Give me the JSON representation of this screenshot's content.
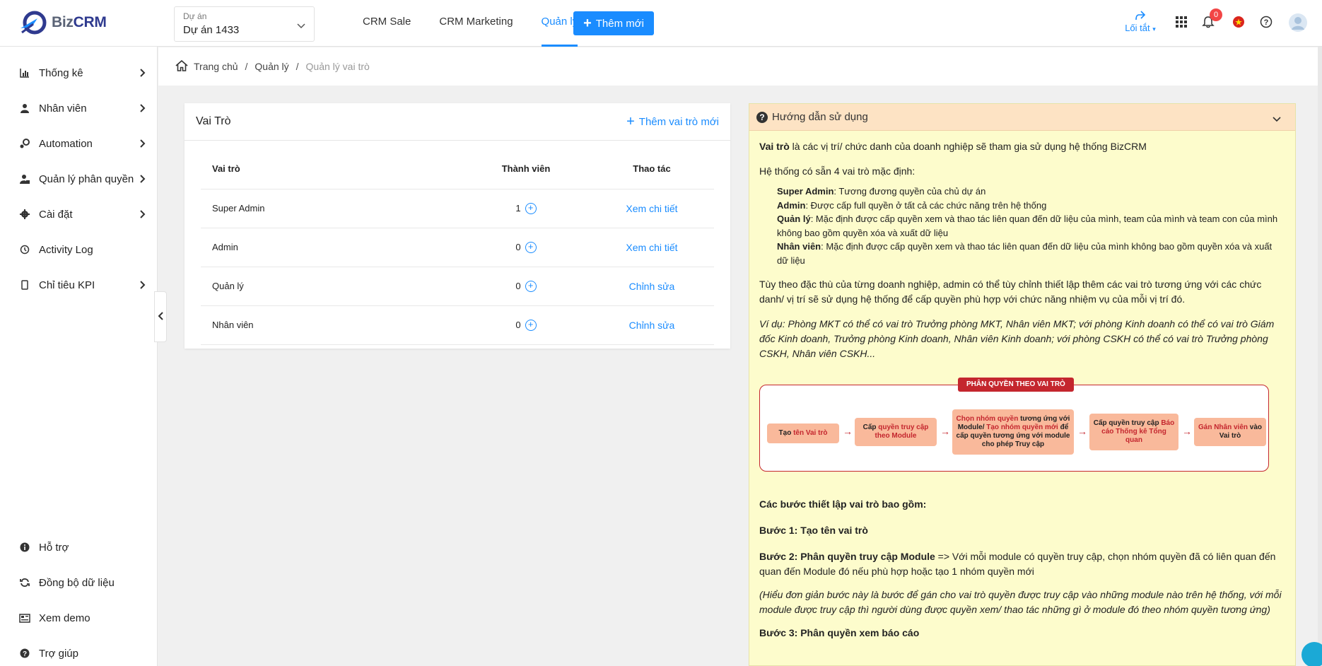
{
  "app": {
    "logo_text_1": "Biz",
    "logo_text_2": "CRM"
  },
  "project": {
    "label": "Dự án",
    "value": "Dự án 1433"
  },
  "topnav": {
    "tabs": [
      "CRM Sale",
      "CRM Marketing",
      "Quản lý"
    ],
    "active_tab": "Quản lý"
  },
  "add_button": {
    "label": "Thêm mới"
  },
  "header": {
    "shortcut_label": "Lối tắt",
    "notification_count": "0"
  },
  "sidebar": {
    "items": [
      {
        "label": "Thống kê",
        "icon": "bar-chart-icon",
        "has_arrow": true
      },
      {
        "label": "Nhân viên",
        "icon": "user-icon",
        "has_arrow": true
      },
      {
        "label": "Automation",
        "icon": "gears-icon",
        "has_arrow": true
      },
      {
        "label": "Quản lý phân quyền",
        "icon": "user-lock-icon",
        "has_arrow": true
      },
      {
        "label": "Cài đặt",
        "icon": "gear-icon",
        "has_arrow": true
      },
      {
        "label": "Activity Log",
        "icon": "history-icon",
        "has_arrow": false
      },
      {
        "label": "Chỉ tiêu KPI",
        "icon": "mobile-icon",
        "has_arrow": true
      }
    ],
    "bottom_items": [
      {
        "label": "Hỗ trợ",
        "icon": "info-icon"
      },
      {
        "label": "Đồng bộ dữ liệu",
        "icon": "sync-icon"
      },
      {
        "label": "Xem demo",
        "icon": "newspaper-icon"
      },
      {
        "label": "Trợ giúp",
        "icon": "question-icon"
      }
    ]
  },
  "breadcrumb": {
    "home": "Trang chủ",
    "parent": "Quản lý",
    "current": "Quản lý vai trò",
    "separator": "/"
  },
  "roles_card": {
    "title": "Vai Trò",
    "add_label": "Thêm vai trò mới",
    "columns": [
      "Vai trò",
      "Thành viên",
      "Thao tác"
    ],
    "rows": [
      {
        "role": "Super Admin",
        "members": "1",
        "action": "Xem chi tiết"
      },
      {
        "role": "Admin",
        "members": "0",
        "action": "Xem chi tiết"
      },
      {
        "role": "Quản lý",
        "members": "0",
        "action": "Chỉnh sửa"
      },
      {
        "role": "Nhân viên",
        "members": "0",
        "action": "Chỉnh sửa"
      }
    ]
  },
  "guide": {
    "title": "Hướng dẫn sử dụng",
    "intro_bold": "Vai trò",
    "intro_rest": " là các vị trí/ chức danh của doanh nghiệp sẽ tham gia sử dụng hệ thống BizCRM",
    "defaults_intro": "Hệ thống có sẵn 4 vai trò mặc định:",
    "defaults": [
      {
        "name": "Super Admin",
        "desc": ": Tương đương quyền của chủ dự án"
      },
      {
        "name": "Admin",
        "desc": ": Được cấp full quyền ở tất cả các chức năng trên hệ thống"
      },
      {
        "name": "Quản lý",
        "desc": ": Mặc định được cấp quyền xem và thao tác liên quan đến dữ liệu của mình, team của mình và team con của mình không bao gồm quyền xóa và xuất dữ liệu"
      },
      {
        "name": "Nhân viên",
        "desc": ": Mặc định được cấp quyền xem và thao tác liên quan đến dữ liệu của mình không bao gồm quyền xóa và xuất dữ liệu"
      }
    ],
    "custom_text": "Tùy theo đặc thù của từng doanh nghiệp, admin có thể tùy chỉnh thiết lập thêm các vai trò tương ứng với các chức danh/ vị trí sẽ sử dụng hệ thống để cấp quyền phù hợp với chức năng nhiệm vụ của mỗi vị trí đó.",
    "example_text": "Ví dụ: Phòng MKT có thể có vai trò Trưởng phòng MKT, Nhân viên MKT; với phòng Kinh doanh có thể có vai trò Giám đốc Kinh doanh, Trưởng phòng Kinh doanh, Nhân viên Kinh doanh; với phòng CSKH có thể có vai trò Trưởng phòng CSKH, Nhân viên CSKH...",
    "flow": {
      "title": "PHÂN QUYỀN THEO VAI TRÒ",
      "step1_a": "Tạo ",
      "step1_b": "tên Vai trò",
      "step2_a": "Cấp ",
      "step2_b": "quyền truy cập theo Module",
      "step3_a": "Chọn nhóm quyền",
      "step3_b": " tương ứng với Module/ ",
      "step3_c": "Tạo nhóm quyền mới",
      "step3_d": " để cấp quyền tương ứng với module cho phép Truy cập",
      "step4_a": "Cấp quyền truy cập ",
      "step4_b": "Báo cáo Thống kê Tổng quan",
      "step5_a": "Gán Nhân viên",
      "step5_b": " vào Vai trò"
    },
    "steps_title": "Các bước thiết lập vai trò bao gồm:",
    "step1": "Bước 1: Tạo tên vai trò",
    "step2_bold": "Bước 2: Phân quyền truy cập Module",
    "step2_rest": " => Với mỗi module có quyền truy cập, chọn nhóm quyền đã có liên quan đến quan đến Module đó nếu phù hợp hoặc tạo 1 nhóm quyền mới",
    "step2_note": "(Hiểu đơn giản bước này là bước để gán cho vai trò quyền được truy cập vào những module nào trên hệ thống, với mỗi module được truy cập thì người dùng được quyền xem/ thao tác những gì ở module đó theo nhóm quyền tương ứng)",
    "step3_bold": "Bước 3",
    "step3_rest": ": Phân quyền xem báo cáo"
  }
}
